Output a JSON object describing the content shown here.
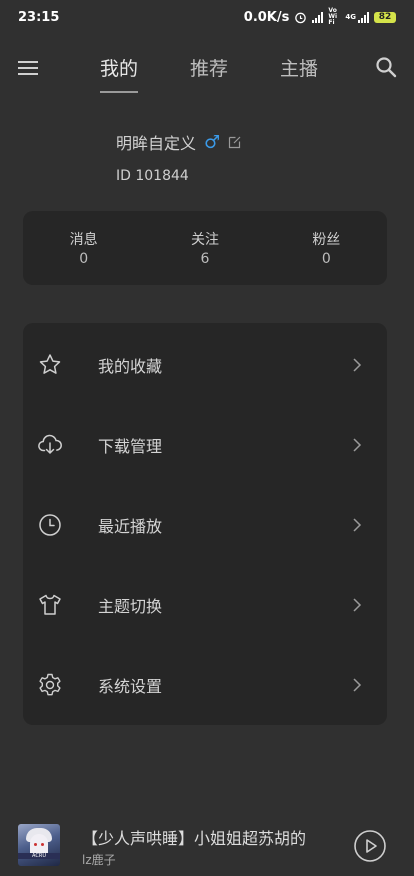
{
  "status_bar": {
    "time": "23:15",
    "speed": "0.0K/s",
    "network_a": "Vo WiFi",
    "network_b": "4G",
    "battery": "82"
  },
  "header": {
    "tabs": [
      {
        "label": "我的"
      },
      {
        "label": "推荐"
      },
      {
        "label": "主播"
      }
    ],
    "active_tab": "我的"
  },
  "profile": {
    "name": "明眸自定义",
    "gender_symbol": "♂",
    "id_text": "ID 101844"
  },
  "stats": [
    {
      "label": "消息",
      "value": "0"
    },
    {
      "label": "关注",
      "value": "6"
    },
    {
      "label": "粉丝",
      "value": "0"
    }
  ],
  "menu": [
    {
      "label": "我的收藏",
      "icon": "star-icon"
    },
    {
      "label": "下载管理",
      "icon": "cloud-download-icon"
    },
    {
      "label": "最近播放",
      "icon": "clock-icon"
    },
    {
      "label": "主题切换",
      "icon": "tshirt-icon"
    },
    {
      "label": "系统设置",
      "icon": "gear-icon"
    }
  ],
  "player": {
    "title": "【少人声哄睡】小姐姐超苏胡的",
    "artist": "lz鹿子",
    "cover_text": "ACRU"
  },
  "colors": {
    "background": "#303030",
    "card": "#262626",
    "gender_accent": "#3b9ae8",
    "battery": "#d4e34a"
  }
}
